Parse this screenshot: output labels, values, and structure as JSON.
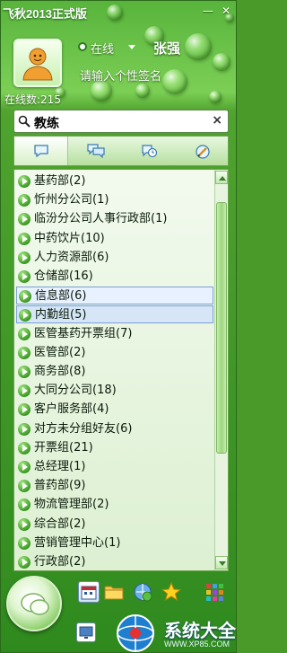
{
  "window": {
    "title": "飞秋2013正式版",
    "controls": {
      "minimize": "—",
      "close": "✕"
    }
  },
  "profile": {
    "status": "在线",
    "nickname": "张强",
    "signature": "请输入个性签名",
    "online_count": "在线数:215"
  },
  "search": {
    "value": "教练",
    "clear_label": "×"
  },
  "tabs": [
    {
      "icon": "chat-bubble-icon",
      "active": true
    },
    {
      "icon": "group-chat-icon",
      "active": false
    },
    {
      "icon": "history-icon",
      "active": false
    },
    {
      "icon": "edit-icon",
      "active": false
    }
  ],
  "groups": [
    {
      "label": "基药部(2)"
    },
    {
      "label": "忻州分公司(1)"
    },
    {
      "label": "临汾分公司人事行政部(1)"
    },
    {
      "label": "中药饮片(10)"
    },
    {
      "label": "人力资源部(6)"
    },
    {
      "label": "仓储部(16)"
    },
    {
      "label": "信息部(6)",
      "state": "highlighted"
    },
    {
      "label": "内勤组(5)",
      "state": "selected"
    },
    {
      "label": "医管基药开票组(7)"
    },
    {
      "label": "医管部(2)"
    },
    {
      "label": "商务部(8)"
    },
    {
      "label": "大同分公司(18)"
    },
    {
      "label": "客户服务部(4)"
    },
    {
      "label": "对方未分组好友(6)"
    },
    {
      "label": "开票组(21)"
    },
    {
      "label": "总经理(1)"
    },
    {
      "label": "普药部(9)"
    },
    {
      "label": "物流管理部(2)"
    },
    {
      "label": "综合部(2)"
    },
    {
      "label": "营销管理中心(1)"
    },
    {
      "label": "行政部(2)"
    }
  ],
  "bottom_toolbar": {
    "icons": [
      "calendar-icon",
      "folder-icon",
      "share-icon",
      "favorite-star-icon",
      "app-grid-icon",
      "messenger-orb-icon"
    ]
  },
  "watermark": {
    "text": "系统大全",
    "url": "WWW.XP85.COM"
  },
  "colors": {
    "accent_green": "#3c9a22",
    "selection_blue": "#7aa0d8"
  }
}
